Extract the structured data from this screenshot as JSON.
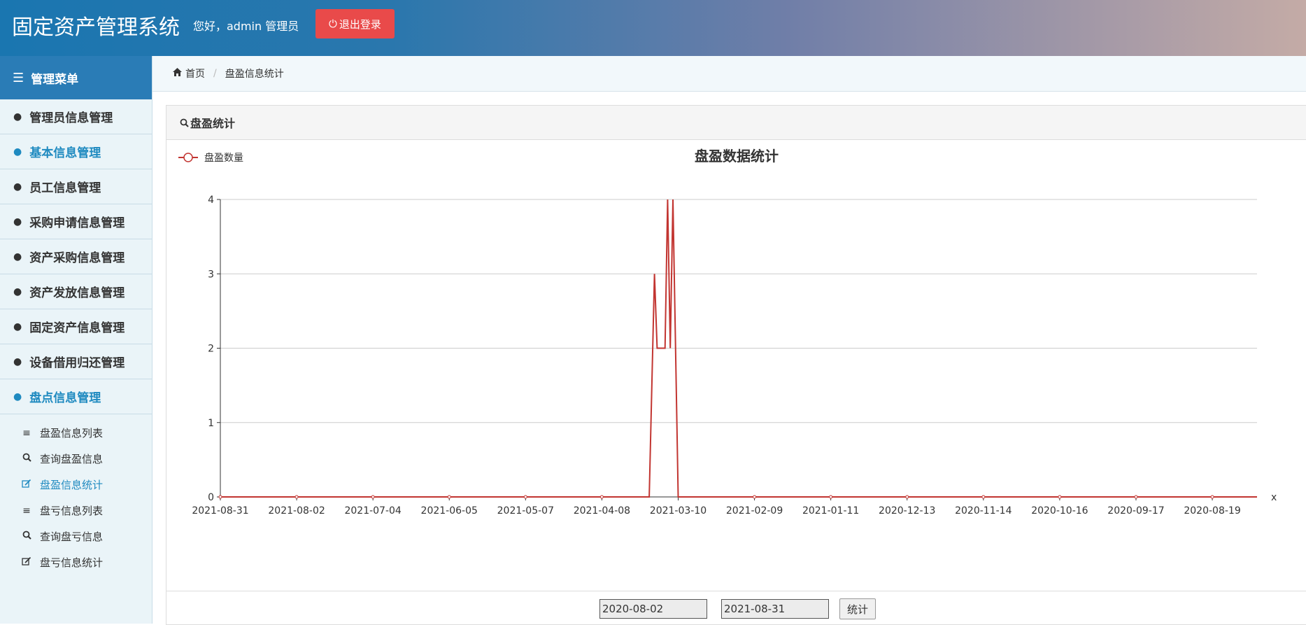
{
  "app": {
    "title": "固定资产管理系统",
    "greeting": "您好，admin  管理员",
    "logout_label": "退出登录"
  },
  "sidebar": {
    "header": "管理菜单",
    "items": [
      {
        "label": "管理员信息管理",
        "active": false
      },
      {
        "label": "基本信息管理",
        "active": true
      },
      {
        "label": "员工信息管理",
        "active": false
      },
      {
        "label": "采购申请信息管理",
        "active": false
      },
      {
        "label": "资产采购信息管理",
        "active": false
      },
      {
        "label": "资产发放信息管理",
        "active": false
      },
      {
        "label": "固定资产信息管理",
        "active": false
      },
      {
        "label": "设备借用归还管理",
        "active": false
      },
      {
        "label": "盘点信息管理",
        "active": true
      }
    ],
    "subitems": [
      {
        "label": "盘盈信息列表",
        "icon": "list-icon"
      },
      {
        "label": "查询盘盈信息",
        "icon": "search-icon"
      },
      {
        "label": "盘盈信息统计",
        "icon": "edit-icon",
        "active": true
      },
      {
        "label": "盘亏信息列表",
        "icon": "list-icon"
      },
      {
        "label": "查询盘亏信息",
        "icon": "search-icon"
      },
      {
        "label": "盘亏信息统计",
        "icon": "edit-icon"
      }
    ]
  },
  "breadcrumb": {
    "home": "首页",
    "current": "盘盈信息统计"
  },
  "panel": {
    "title": "盘盈统计"
  },
  "filter": {
    "start_date": "2020-08-02",
    "end_date": "2021-08-31",
    "submit_label": "统计"
  },
  "colors": {
    "series": "#c23531",
    "active_menu": "#1f8ac0",
    "logout_bg": "#e94a4a"
  },
  "chart_data": {
    "type": "line",
    "title": "盘盈数据统计",
    "legend": "盘盈数量",
    "legend_position": "top-left",
    "xlabel": "x",
    "ylabel": "",
    "ylim": [
      0,
      4
    ],
    "yticks": [
      0,
      1,
      2,
      3,
      4
    ],
    "grid": true,
    "tick_labels": [
      "2021-08-31",
      "2021-08-02",
      "2021-07-04",
      "2021-06-05",
      "2021-05-07",
      "2021-04-08",
      "2021-03-10",
      "2021-02-09",
      "2021-01-11",
      "2020-12-13",
      "2020-11-14",
      "2020-10-16",
      "2020-09-17",
      "2020-08-19"
    ],
    "x_start": "2021-08-31",
    "x_end": "2020-08-02",
    "series": [
      {
        "name": "盘盈数量",
        "points": [
          [
            "2021-08-31",
            0
          ],
          [
            "2021-03-21",
            0
          ],
          [
            "2021-03-19",
            3
          ],
          [
            "2021-03-18",
            2
          ],
          [
            "2021-03-15",
            2
          ],
          [
            "2021-03-14",
            4
          ],
          [
            "2021-03-13",
            2
          ],
          [
            "2021-03-12",
            4
          ],
          [
            "2021-03-10",
            0
          ],
          [
            "2020-08-02",
            0
          ]
        ]
      }
    ]
  }
}
